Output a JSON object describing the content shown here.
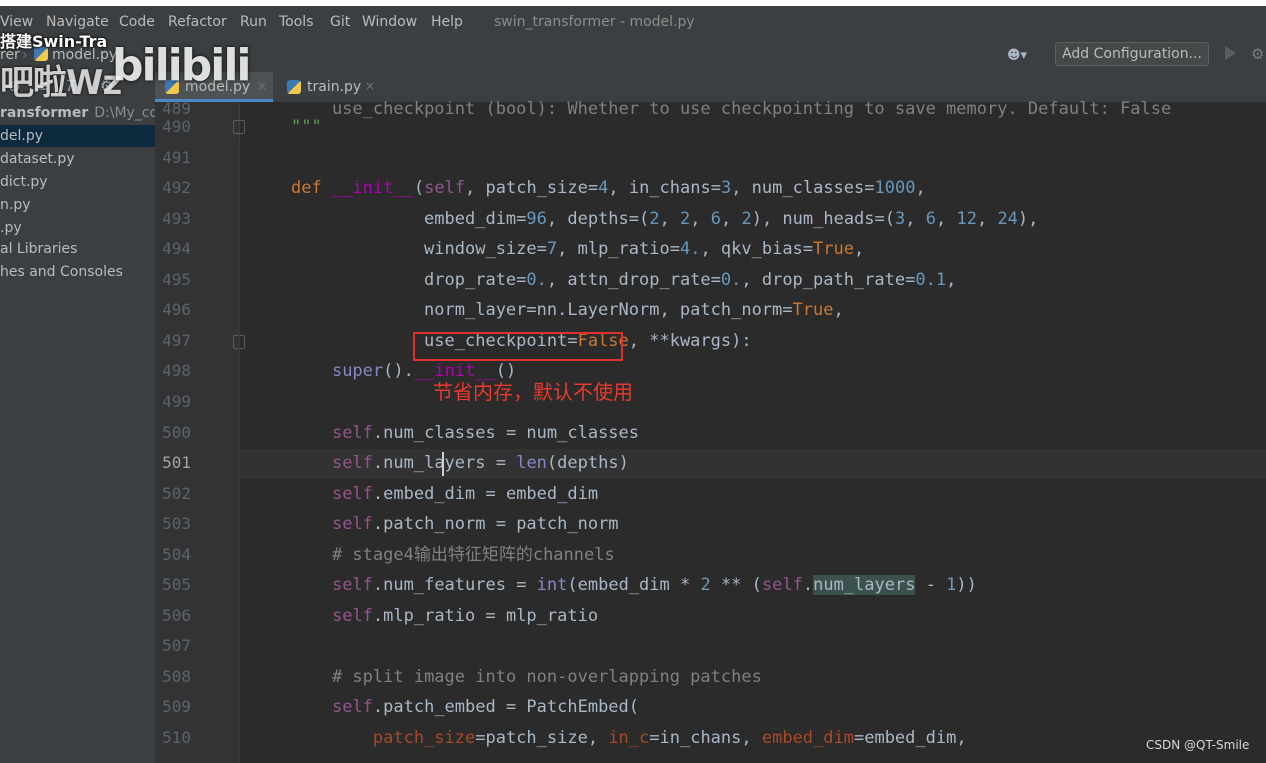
{
  "menu": {
    "items": [
      "View",
      "Navigate",
      "Code",
      "Refactor",
      "Run",
      "Tools",
      "Git",
      "Window",
      "Help"
    ],
    "window_title": "swin_transformer - model.py"
  },
  "navbar": {
    "breadcrumb_project": "rer",
    "breadcrumb_file": "model.py",
    "user_icon": "user-dropdown-icon",
    "add_configuration": "Add Configuration...",
    "run_icon": "play-icon",
    "settings_icon": "gear-icon"
  },
  "tabs": [
    {
      "label": "model.py",
      "close": "×",
      "active": true
    },
    {
      "label": "train.py",
      "close": "×",
      "active": false
    }
  ],
  "sidebar": {
    "items": [
      {
        "label": "ransformer",
        "path": "D:\\My_code",
        "root": true
      },
      {
        "label": "del.py",
        "selected": true
      },
      {
        "label": "dataset.py"
      },
      {
        "label": "dict.py"
      },
      {
        "label": "n.py"
      },
      {
        "label": ".py"
      },
      {
        "label": "al Libraries"
      },
      {
        "label": "hes and Consoles"
      }
    ]
  },
  "editor": {
    "line_numbers": [
      "490",
      "491",
      "492",
      "493",
      "494",
      "495",
      "496",
      "497",
      "498",
      "499",
      "500",
      "501",
      "502",
      "503",
      "504",
      "505",
      "506",
      "507",
      "508",
      "509",
      "510"
    ],
    "current_line": "501",
    "partial_top_line": "use_checkpoint (bool): Whether to use checkpointing to save memory. Default: False"
  },
  "annotation": {
    "text": "节省内存，默认不使用",
    "color": "#e83a2e"
  },
  "overlays": {
    "video_title": "搭建Swin-Tra",
    "uploader": "吧啦Wz",
    "logo": "bilibili",
    "watermark": "CSDN @QT-Smile"
  },
  "colors": {
    "editor_bg": "#2b2b2b",
    "keyword": "#cc7832",
    "number": "#6897bb",
    "self": "#94558d",
    "comment": "#808080",
    "highlight_box": "#e03030"
  }
}
